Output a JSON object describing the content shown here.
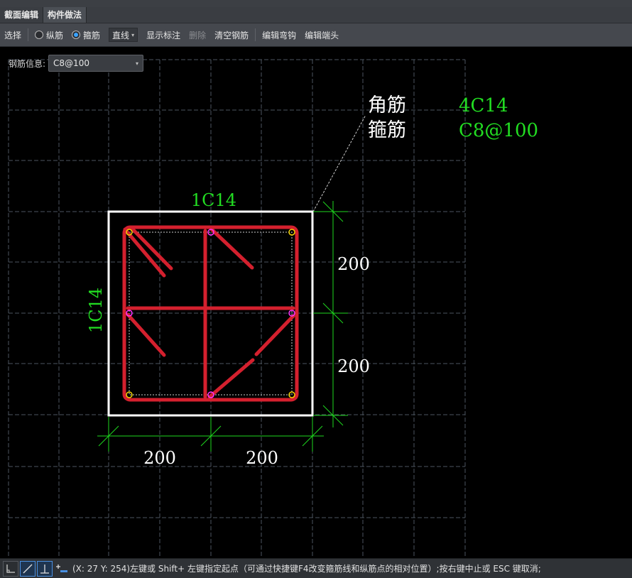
{
  "tabs": [
    {
      "label": "截面编辑"
    },
    {
      "label": "构件做法"
    }
  ],
  "toolbar": {
    "select": "选择",
    "longitudinal": "纵筋",
    "stirrup": "箍筋",
    "line_mode": "直线",
    "show_dims": "显示标注",
    "delete": "删除",
    "clear_rebar": "清空钢筋",
    "edit_hook": "编辑弯钩",
    "edit_end": "编辑端头"
  },
  "rebar_info": {
    "label": "钢筋信息:",
    "value": "C8@100"
  },
  "drawing": {
    "corner_label": "角筋",
    "corner_value": "4C14",
    "stirrup_label": "箍筋",
    "stirrup_value": "C8@100",
    "top_rebar": "1C14",
    "left_rebar": "1C14",
    "dim_right_upper": "200",
    "dim_right_lower": "200",
    "dim_bottom_left": "200",
    "dim_bottom_right": "200"
  },
  "colors": {
    "rebar": "#d4202e",
    "dimension": "#1ed81e",
    "green_text": "#22dd22",
    "section_border": "#ffffff",
    "grid": "#5a6470",
    "corner_point": "#f0d000",
    "mid_point": "#ff30ff"
  },
  "status": {
    "text": "(X: 27 Y: 254)左键或 Shift+ 左键指定起点（可通过快捷键F4改变箍筋线和纵筋点的相对位置）;按右键中止或 ESC 键取消;"
  }
}
